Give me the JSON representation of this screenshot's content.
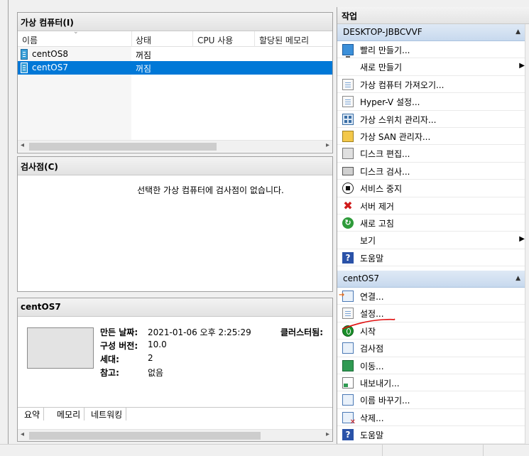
{
  "vm_panel": {
    "title": "가상 컴퓨터(I)",
    "columns": [
      "이름",
      "상태",
      "CPU 사용",
      "할당된 메모리"
    ],
    "rows": [
      {
        "name": "centOS8",
        "state": "꺼짐",
        "selected": false
      },
      {
        "name": "centOS7",
        "state": "꺼짐",
        "selected": true
      }
    ]
  },
  "checkpoint_panel": {
    "title": "검사점(C)",
    "empty_message": "선택한 가상 컴퓨터에 검사점이 없습니다."
  },
  "detail_panel": {
    "title": "centOS7",
    "fields": [
      {
        "label": "만든 날짜:",
        "value": "2021-01-06 오후 2:25:29"
      },
      {
        "label": "구성 버전:",
        "value": "10.0"
      },
      {
        "label": "세대:",
        "value": "2"
      },
      {
        "label": "참고:",
        "value": "없음"
      }
    ],
    "cluster_label": "클러스터됨:",
    "tabs": [
      "요약",
      "메모리",
      "네트워킹"
    ]
  },
  "actions": {
    "title": "작업",
    "host_group": {
      "name": "DESKTOP-JBBCVVF",
      "items": [
        {
          "label": "빨리 만들기...",
          "icon": "quick-create-icon"
        },
        {
          "label": "새로 만들기",
          "icon": "none",
          "submenu": true
        },
        {
          "label": "가상 컴퓨터 가져오기...",
          "icon": "import-vm-icon"
        },
        {
          "label": "Hyper-V 설정...",
          "icon": "hyperv-settings-icon"
        },
        {
          "label": "가상 스위치 관리자...",
          "icon": "virtual-switch-icon"
        },
        {
          "label": "가상 SAN 관리자...",
          "icon": "virtual-san-icon"
        },
        {
          "label": "디스크 편집...",
          "icon": "edit-disk-icon"
        },
        {
          "label": "디스크 검사...",
          "icon": "inspect-disk-icon"
        },
        {
          "label": "서비스 중지",
          "icon": "stop-service-icon"
        },
        {
          "label": "서버 제거",
          "icon": "remove-server-icon"
        },
        {
          "label": "새로 고침",
          "icon": "refresh-icon"
        },
        {
          "label": "보기",
          "icon": "none",
          "submenu": true
        },
        {
          "label": "도움말",
          "icon": "help-icon"
        }
      ]
    },
    "vm_group": {
      "name": "centOS7",
      "items": [
        {
          "label": "연결...",
          "icon": "connect-icon"
        },
        {
          "label": "설정...",
          "icon": "settings-icon"
        },
        {
          "label": "시작",
          "icon": "start-icon"
        },
        {
          "label": "검사점",
          "icon": "checkpoint-icon"
        },
        {
          "label": "이동...",
          "icon": "move-icon"
        },
        {
          "label": "내보내기...",
          "icon": "export-icon"
        },
        {
          "label": "이름 바꾸기...",
          "icon": "rename-icon"
        },
        {
          "label": "삭제...",
          "icon": "delete-icon"
        },
        {
          "label": "도움말",
          "icon": "help-icon"
        }
      ]
    }
  },
  "colors": {
    "selection": "#0078d7",
    "group_header": "#c7d9ee",
    "annotation_stroke": "#e01010"
  }
}
